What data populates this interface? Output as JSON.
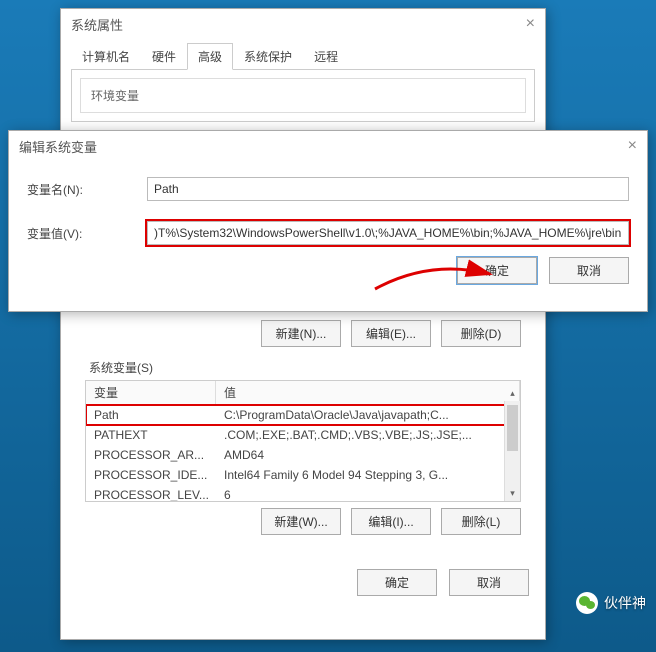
{
  "sysprops": {
    "title": "系统属性",
    "tabs": [
      "计算机名",
      "硬件",
      "高级",
      "系统保护",
      "远程"
    ],
    "active_tab": 2,
    "env_label": "环境变量"
  },
  "editvar": {
    "title": "编辑系统变量",
    "name_label": "变量名(N):",
    "name_value": "Path",
    "value_label": "变量值(V):",
    "value_value": ")T%\\System32\\WindowsPowerShell\\v1.0\\;%JAVA_HOME%\\bin;%JAVA_HOME%\\jre\\bin;",
    "ok": "确定",
    "cancel": "取消"
  },
  "uservars_buttons": {
    "new": "新建(N)...",
    "edit": "编辑(E)...",
    "delete": "删除(D)"
  },
  "sysvars": {
    "label": "系统变量(S)",
    "col1": "变量",
    "col2": "值",
    "rows": [
      {
        "name": "Path",
        "value": "C:\\ProgramData\\Oracle\\Java\\javapath;C..."
      },
      {
        "name": "PATHEXT",
        "value": ".COM;.EXE;.BAT;.CMD;.VBS;.VBE;.JS;.JSE;..."
      },
      {
        "name": "PROCESSOR_AR...",
        "value": "AMD64"
      },
      {
        "name": "PROCESSOR_IDE...",
        "value": "Intel64 Family 6 Model 94 Stepping 3, G..."
      },
      {
        "name": "PROCESSOR_LEV...",
        "value": "6"
      }
    ],
    "selected": 0,
    "buttons": {
      "new": "新建(W)...",
      "edit": "编辑(I)...",
      "delete": "删除(L)"
    }
  },
  "dialog_buttons": {
    "ok": "确定",
    "cancel": "取消"
  },
  "watermark": "伙伴神"
}
